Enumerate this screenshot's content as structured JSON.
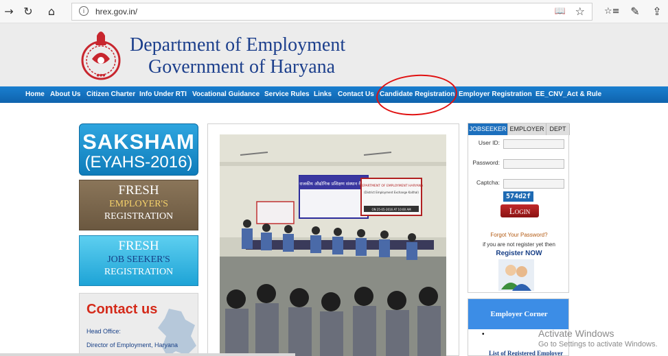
{
  "browser": {
    "url": "hrex.gov.in/",
    "back_glyph": "→",
    "reload_glyph": "↻",
    "home_glyph": "⌂",
    "info_glyph": "i",
    "reader_glyph": "📖",
    "star_glyph": "☆",
    "favorites_glyph": "☆≡",
    "pen_glyph": "✎",
    "share_glyph": "⇪"
  },
  "header": {
    "title_line1": "Department of Employment",
    "title_line2": "Government of Haryana"
  },
  "menu": {
    "items": [
      "Home",
      "About Us",
      "Citizen Charter",
      "Info Under RTI",
      "Vocational Guidance",
      "Service Rules",
      "Links",
      "Contact Us",
      "Candidate Registration",
      "Employer Registration",
      "EE_CNV_Act & Rule"
    ]
  },
  "left": {
    "saksham_title": "SAKSHAM",
    "saksham_sub": "(EYAHS-2016)",
    "fresh_employer": [
      "FRESH",
      "EMPLOYER'S",
      "REGISTRATION"
    ],
    "fresh_jobseeker": [
      "FRESH",
      "JOB SEEKER'S",
      "REGISTRATION"
    ],
    "contact_title": "Contact us",
    "contact_head": "Head Office:",
    "contact_director": "Director of Employment, Haryana"
  },
  "login": {
    "tabs": [
      "JOBSEEKER",
      "EMPLOYER",
      "DEPT"
    ],
    "user_id_label": "User ID:",
    "password_label": "Password:",
    "captcha_label": "Captcha:",
    "captcha_value": "574d2f",
    "login_button": "Login",
    "forgot": "Forgot Your Password?",
    "not_registered": "if you are not register yet then",
    "register_now": "Register NOW"
  },
  "employer_corner": {
    "title": "Employer Corner",
    "bullet": "•",
    "link": "List of Registered Employer"
  },
  "photo_banners": {
    "banner_left": "राजकीय औद्योगिक प्रशिक्षण संस्थान कैथल",
    "banner_right": "DEPARTMENT OF EMPLOYMENT HARYANA",
    "banner_right_sub": "(District Employment Exchange Kaithal)",
    "banner_date": "ON 25-05-2016 AT 10:00 AM"
  },
  "watermark": {
    "title": "Activate Windows",
    "subtitle": "Go to Settings to activate Windows."
  },
  "colors": {
    "menu_blue": "#1a7fd0",
    "title_blue": "#1c3f8c",
    "highlight_red": "#e01010"
  }
}
